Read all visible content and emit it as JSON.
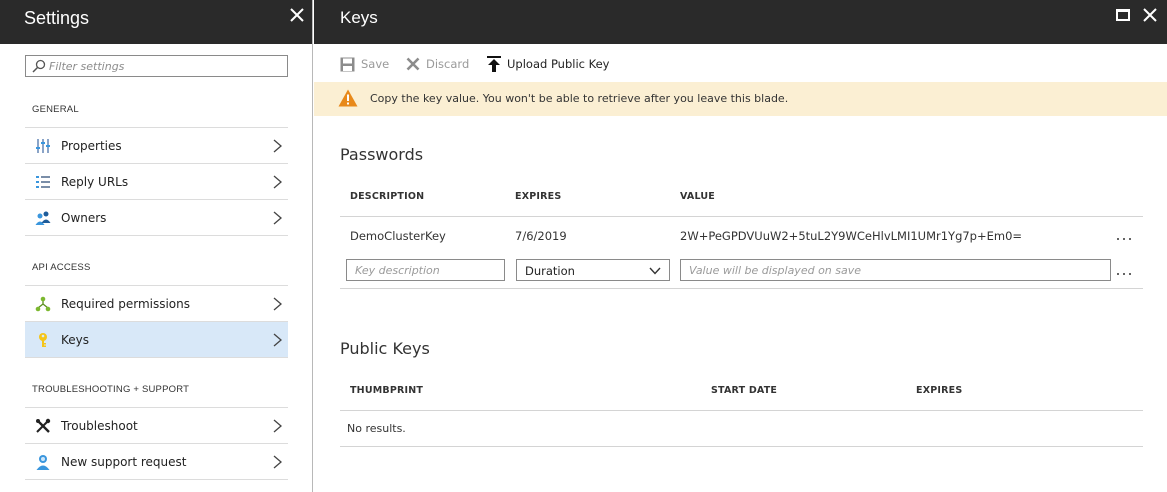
{
  "settings": {
    "title": "Settings",
    "filter_placeholder": "Filter settings",
    "sections": [
      {
        "heading": "GENERAL",
        "items": [
          {
            "label": "Properties",
            "icon": "properties-icon"
          },
          {
            "label": "Reply URLs",
            "icon": "reply-urls-icon"
          },
          {
            "label": "Owners",
            "icon": "owners-icon"
          }
        ]
      },
      {
        "heading": "API ACCESS",
        "items": [
          {
            "label": "Required permissions",
            "icon": "permissions-icon"
          },
          {
            "label": "Keys",
            "icon": "key-icon",
            "active": true
          }
        ]
      },
      {
        "heading": "TROUBLESHOOTING + SUPPORT",
        "items": [
          {
            "label": "Troubleshoot",
            "icon": "troubleshoot-icon"
          },
          {
            "label": "New support request",
            "icon": "support-request-icon"
          }
        ]
      }
    ]
  },
  "keys": {
    "title": "Keys",
    "toolbar": {
      "save_label": "Save",
      "discard_label": "Discard",
      "upload_label": "Upload Public Key"
    },
    "warning": "Copy the key value. You won't be able to retrieve after you leave this blade.",
    "passwords": {
      "heading": "Passwords",
      "columns": [
        "DESCRIPTION",
        "EXPIRES",
        "VALUE"
      ],
      "rows": [
        {
          "description": "DemoClusterKey",
          "expires": "7/6/2019",
          "value": "2W+PeGPDVUuW2+5tuL2Y9WCeHlvLMI1UMr1Yg7p+Em0="
        }
      ],
      "new_row": {
        "description_placeholder": "Key description",
        "duration_value": "Duration",
        "value_placeholder": "Value will be displayed on save"
      }
    },
    "public_keys": {
      "heading": "Public Keys",
      "columns": [
        "THUMBPRINT",
        "START DATE",
        "EXPIRES"
      ],
      "empty_text": "No results."
    }
  },
  "colors": {
    "header_bg": "#2a2a2a",
    "active_item_bg": "#d8e8f8",
    "warning_bg": "#fbefd3",
    "warning_icon": "#e8891a",
    "accent_blue": "#3a96dd"
  }
}
